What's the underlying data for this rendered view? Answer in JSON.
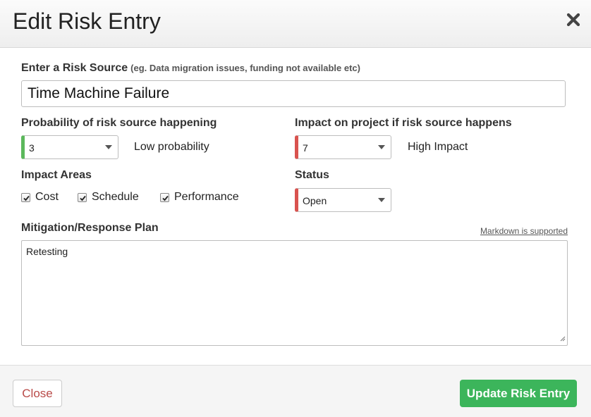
{
  "header": {
    "title": "Edit Risk Entry",
    "close_icon": "close-icon"
  },
  "risk_source": {
    "label": "Enter a Risk Source",
    "hint": "(eg. Data migration issues, funding not available etc)",
    "value": "Time Machine Failure"
  },
  "probability": {
    "label": "Probability of risk source happening",
    "value": "3",
    "description": "Low probability",
    "edge_color": "#5cb85c"
  },
  "impact": {
    "label": "Impact on project if risk source happens",
    "value": "7",
    "description": "High Impact",
    "edge_color": "#d9534f"
  },
  "impact_areas": {
    "label": "Impact Areas",
    "items": [
      {
        "label": "Cost",
        "checked": true
      },
      {
        "label": "Schedule",
        "checked": true
      },
      {
        "label": "Performance",
        "checked": true
      }
    ]
  },
  "status": {
    "label": "Status",
    "value": "Open",
    "edge_color": "#d9534f"
  },
  "mitigation": {
    "label": "Mitigation/Response Plan",
    "markdown_link": "Markdown is supported",
    "value": "Retesting"
  },
  "footer": {
    "close_label": "Close",
    "update_label": "Update Risk Entry",
    "update_color": "#3cb55b"
  }
}
